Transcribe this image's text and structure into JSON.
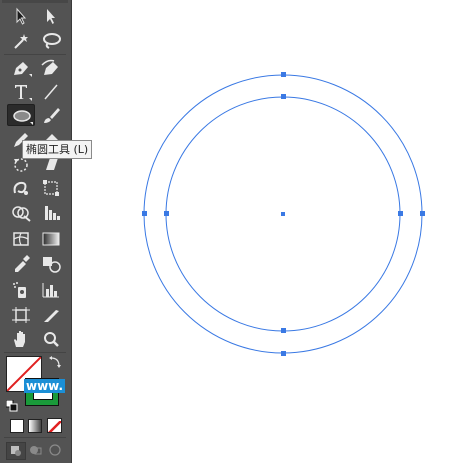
{
  "toolbar": {
    "tools": [
      {
        "name": "selection-tool-icon"
      },
      {
        "name": "direct-selection-tool-icon"
      },
      {
        "name": "magic-wand-tool-icon"
      },
      {
        "name": "lasso-tool-icon"
      },
      {
        "name": "pen-tool-icon"
      },
      {
        "name": "curvature-tool-icon"
      },
      {
        "name": "type-tool-icon"
      },
      {
        "name": "line-segment-tool-icon"
      },
      {
        "name": "ellipse-tool-icon",
        "active": true
      },
      {
        "name": "paintbrush-tool-icon"
      },
      {
        "name": "pencil-tool-icon"
      },
      {
        "name": "eraser-tool-icon"
      },
      {
        "name": "rotate-tool-icon"
      },
      {
        "name": "shear-tool-icon"
      },
      {
        "name": "warp-tool-icon"
      },
      {
        "name": "free-transform-tool-icon"
      },
      {
        "name": "shape-builder-tool-icon"
      },
      {
        "name": "perspective-grid-tool-icon"
      },
      {
        "name": "mesh-tool-icon"
      },
      {
        "name": "gradient-tool-icon"
      },
      {
        "name": "eyedropper-tool-icon"
      },
      {
        "name": "blend-tool-icon"
      },
      {
        "name": "symbol-sprayer-tool-icon"
      },
      {
        "name": "column-graph-tool-icon"
      },
      {
        "name": "artboard-tool-icon"
      },
      {
        "name": "slice-tool-icon"
      },
      {
        "name": "hand-tool-icon"
      },
      {
        "name": "zoom-tool-icon"
      }
    ],
    "fill_color": "#ffffff",
    "stroke_color": "#1a9a3a"
  },
  "tooltip": {
    "text": "椭圆工具 (L)"
  },
  "watermark": {
    "text": "www."
  },
  "canvas": {
    "shape_color": "#3a79e4",
    "shapes": [
      "outer-ellipse",
      "inner-ellipse"
    ]
  }
}
